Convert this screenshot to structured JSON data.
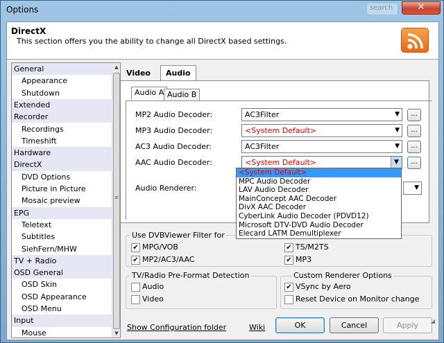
{
  "window": {
    "title": "Options",
    "close_label": "✕",
    "ghost_label": "search"
  },
  "header": {
    "title": "DirectX",
    "description": "This section offers you the ability to change all DirectX based settings."
  },
  "sidebar": {
    "items": [
      {
        "label": "General",
        "type": "cat"
      },
      {
        "label": "Appearance",
        "type": "sub"
      },
      {
        "label": "Shutdown",
        "type": "sub"
      },
      {
        "label": "Extended",
        "type": "cat"
      },
      {
        "label": "Recorder",
        "type": "cat"
      },
      {
        "label": "Recordings",
        "type": "sub"
      },
      {
        "label": "Timeshift",
        "type": "sub"
      },
      {
        "label": "Hardware",
        "type": "cat"
      },
      {
        "label": "DirectX",
        "type": "cat"
      },
      {
        "label": "DVD Options",
        "type": "sub"
      },
      {
        "label": "Picture in Picture",
        "type": "sub"
      },
      {
        "label": "Mosaic preview",
        "type": "sub"
      },
      {
        "label": "EPG",
        "type": "cat"
      },
      {
        "label": "Teletext",
        "type": "sub"
      },
      {
        "label": "Subtitles",
        "type": "sub"
      },
      {
        "label": "SiehFern/MHW",
        "type": "sub"
      },
      {
        "label": "TV + Radio",
        "type": "cat"
      },
      {
        "label": "OSD General",
        "type": "cat"
      },
      {
        "label": "OSD Skin",
        "type": "sub"
      },
      {
        "label": "OSD Appearance",
        "type": "sub"
      },
      {
        "label": "OSD Menu",
        "type": "sub"
      },
      {
        "label": "Input",
        "type": "cat"
      },
      {
        "label": "Mouse",
        "type": "sub"
      }
    ]
  },
  "tabs": {
    "video": "Video",
    "audio": "Audio",
    "audio_a": "Audio A",
    "audio_b": "Audio B"
  },
  "decoders": [
    {
      "label": "MP2 Audio Decoder:",
      "value": "AC3Filter",
      "red": false
    },
    {
      "label": "MP3 Audio Decoder:",
      "value": "<System Default>",
      "red": true
    },
    {
      "label": "AC3 Audio Decoder:",
      "value": "AC3Filter",
      "red": false
    },
    {
      "label": "AAC Audio Decoder:",
      "value": "<System Default>",
      "red": true
    }
  ],
  "dots_label": "...",
  "renderer": {
    "label": "Audio Renderer:"
  },
  "dropdown": {
    "options": [
      "<System Default>",
      "MPC Audio Decoder",
      "LAV Audio Decoder",
      "MainConcept AAC Decoder",
      "DivX AAC Decoder",
      "CyberLink Audio Decoder (PDVD12)",
      "Microsoft DTV-DVD Audio Decoder",
      "Elecard LATM Demultiplexer"
    ],
    "selected_index": 0
  },
  "dvb_filter": {
    "title": "Use DVBViewer Filter for",
    "items": [
      {
        "label": "MPG/VOB",
        "checked": true
      },
      {
        "label": "TS/M2TS",
        "checked": true
      },
      {
        "label": "MP2/AC3/AAC",
        "checked": true
      },
      {
        "label": "MP3",
        "checked": true
      }
    ]
  },
  "preformat": {
    "title": "TV/Radio Pre-Format Detection",
    "items": [
      {
        "label": "Audio",
        "checked": false
      },
      {
        "label": "Video",
        "checked": false
      }
    ]
  },
  "renderer_opts": {
    "title": "Custom Renderer Options",
    "items": [
      {
        "label": "VSync by Aero",
        "checked": true
      },
      {
        "label": "Reset Device on Monitor change",
        "checked": false
      }
    ]
  },
  "footer": {
    "show_config": "Show Configuration folder",
    "wiki": "Wiki",
    "ok": "OK",
    "cancel": "Cancel",
    "apply": "Apply"
  },
  "colors": {
    "accent_select": "#3399ff",
    "warning_text": "#e00000",
    "sidebar_category": "#e6e6f5"
  }
}
